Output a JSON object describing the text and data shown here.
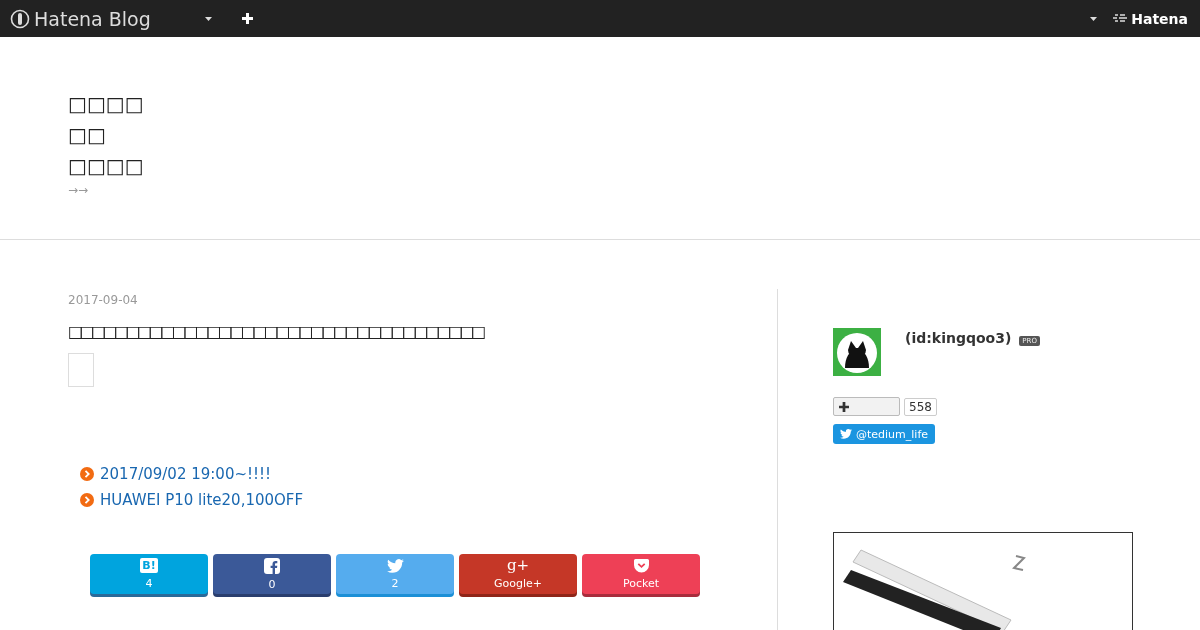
{
  "topbar": {
    "logo": "Hatena Blog",
    "brand": "Hatena"
  },
  "blog": {
    "title_lines": [
      "□□□□",
      "□□",
      "□□□□"
    ],
    "description": "→→"
  },
  "entry": {
    "date": "2017-09-04",
    "title": "□□□□□□□□□□□□□□□□□□□□□□□□□□□□□□□□□□□□",
    "links": [
      "2017/09/02 19:00~!!!!",
      "HUAWEI P10 lite20,100OFF"
    ],
    "share": [
      {
        "kind": "hatena",
        "icon_text": "B!",
        "label": "4"
      },
      {
        "kind": "facebook",
        "label": "0"
      },
      {
        "kind": "twitter",
        "label": "2"
      },
      {
        "kind": "google",
        "icon_text": "g+",
        "label": "Google+"
      },
      {
        "kind": "pocket",
        "label": "Pocket"
      }
    ]
  },
  "sidebar": {
    "profile": {
      "id": "(id:kingqoo3)",
      "badge": "PRO"
    },
    "follow_count": "558",
    "twitter": "@tedium_life"
  }
}
